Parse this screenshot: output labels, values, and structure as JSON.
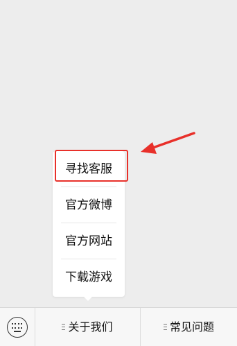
{
  "menu": {
    "items": [
      {
        "label": "寻找客服"
      },
      {
        "label": "官方微博"
      },
      {
        "label": "官方网站"
      },
      {
        "label": "下载游戏"
      }
    ]
  },
  "bottom_bar": {
    "keyboard_icon": "keyboard-icon",
    "tabs": [
      {
        "label": "关于我们",
        "icon": "menu-icon"
      },
      {
        "label": "常见问题",
        "icon": "menu-icon"
      }
    ]
  },
  "colors": {
    "highlight": "#e8302a",
    "background": "#ededed"
  }
}
